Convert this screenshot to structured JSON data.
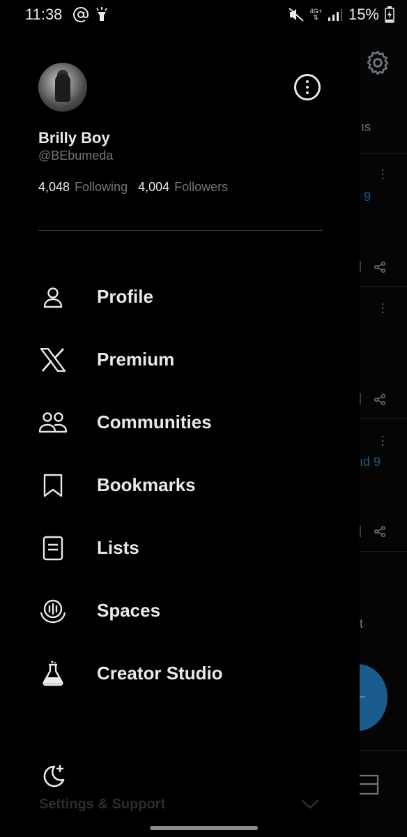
{
  "status_bar": {
    "time": "11:38",
    "network": "4G+",
    "battery": "15%"
  },
  "background": {
    "tab_fragment": "ıs",
    "blue_fragment_1": "9",
    "blue_fragment_2": "ıd 9",
    "text_fragment": "t"
  },
  "profile": {
    "name": "Brilly Boy",
    "handle": "@BEbumeda",
    "following_count": "4,048",
    "following_label": "Following",
    "followers_count": "4,004",
    "followers_label": "Followers"
  },
  "menu": {
    "items": [
      {
        "label": "Profile",
        "icon": "person-icon"
      },
      {
        "label": "Premium",
        "icon": "x-logo-icon"
      },
      {
        "label": "Communities",
        "icon": "communities-icon"
      },
      {
        "label": "Bookmarks",
        "icon": "bookmark-icon"
      },
      {
        "label": "Lists",
        "icon": "list-icon"
      },
      {
        "label": "Spaces",
        "icon": "spaces-icon"
      },
      {
        "label": "Creator Studio",
        "icon": "flask-icon"
      }
    ]
  },
  "footer": {
    "settings_support_label": "Settings & Support"
  },
  "colors": {
    "background": "#000000",
    "text_primary": "#e7e9ea",
    "text_secondary": "#71767b",
    "divider": "#2f3336",
    "accent": "#1d9bf0"
  }
}
